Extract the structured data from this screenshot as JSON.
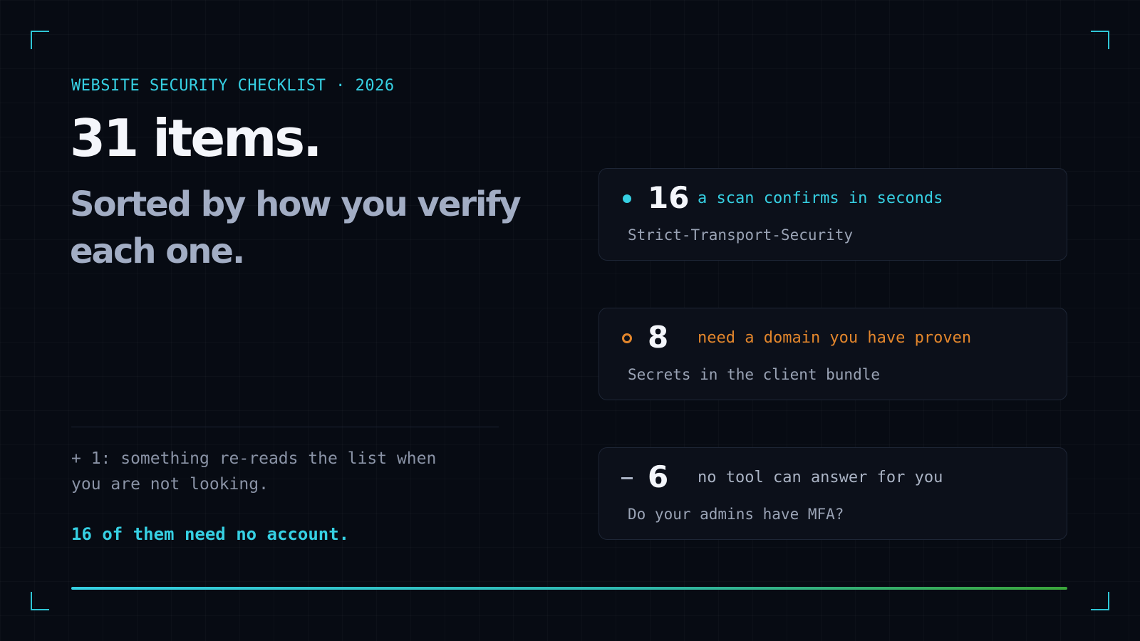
{
  "eyebrow": "WEBSITE SECURITY CHECKLIST · 2026",
  "headline": "31 items.",
  "subhead": "Sorted by how you verify each one.",
  "footnote": "+ 1: something re-reads the list when you are not looking.",
  "callout": "16 of them need no account.",
  "categories": [
    {
      "marker": "dot",
      "color": "#36d0e3",
      "count": "16",
      "label": "a scan confirms in seconds",
      "example": "Strict-Transport-Security"
    },
    {
      "marker": "ring",
      "color": "#e3862c",
      "count": "8",
      "label": "need a domain you have proven",
      "example": "Secrets in the client bundle"
    },
    {
      "marker": "dash",
      "color": "#aab3c4",
      "count": "6",
      "label": "no tool can answer for you",
      "example": "Do your admins have MFA?"
    }
  ],
  "colors": {
    "accent": "#36d0e3",
    "warning": "#e3862c",
    "muted": "#aab3c4",
    "background": "#070b13"
  }
}
